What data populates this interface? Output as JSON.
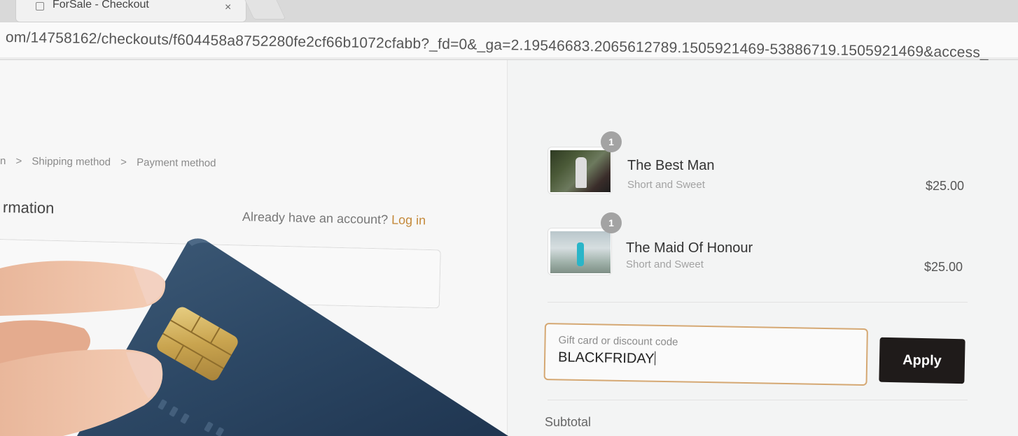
{
  "browser": {
    "tab_title": "ForSale - Checkout",
    "tab_close": "×",
    "url": "om/14758162/checkouts/f604458a8752280fe2cf66b1072cfabb?_fd=0&_ga=2.19546683.2065612789.1505921469-53886719.1505921469&access_"
  },
  "checkout": {
    "breadcrumb": [
      "n",
      ">",
      "Shipping method",
      ">",
      "Payment method"
    ],
    "section_title": "rmation",
    "account_prompt": "Already have an account?",
    "login_label": "Log in"
  },
  "summary": {
    "items": [
      {
        "name": "The Best Man",
        "variant": "Short and Sweet",
        "price": "$25.00",
        "quantity": "1"
      },
      {
        "name": "The Maid Of Honour",
        "variant": "Short and Sweet",
        "price": "$25.00",
        "quantity": "1"
      }
    ],
    "discount": {
      "label": "Gift card or discount code",
      "value": "BLACKFRIDAY",
      "apply_label": "Apply"
    },
    "subtotal_label": "Subtotal"
  },
  "colors": {
    "accent": "#c4893a",
    "focus_border": "#d5a873",
    "button": "#1f1b1a",
    "card": "#2e4a66"
  },
  "icons": [
    "page-icon",
    "close-icon",
    "chevron-right-icon"
  ]
}
